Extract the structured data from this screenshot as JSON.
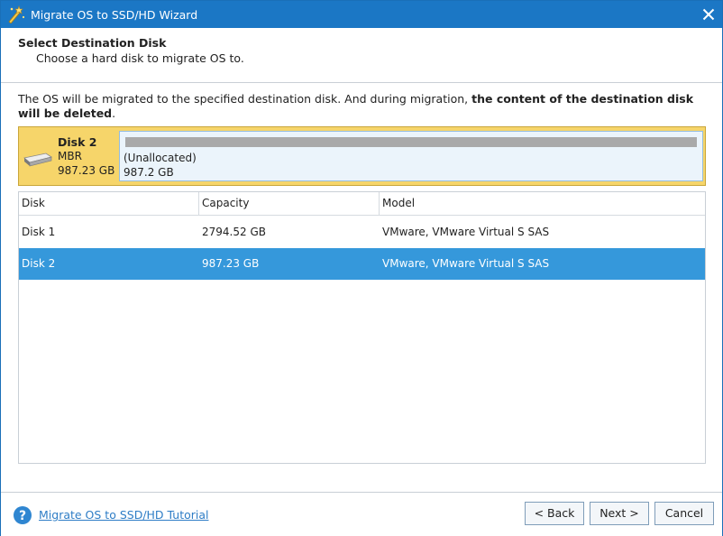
{
  "window": {
    "title": "Migrate OS to SSD/HD Wizard"
  },
  "header": {
    "title": "Select Destination Disk",
    "subtitle": "Choose a hard disk to migrate OS to."
  },
  "warning": {
    "normal": "The OS will be migrated to the specified destination disk. And during migration, ",
    "bold": "the content of the destination disk will be deleted",
    "end": "."
  },
  "selected_disk": {
    "name": "Disk 2",
    "type": "MBR",
    "size": "987.23 GB",
    "partition_label": "(Unallocated)",
    "partition_size": "987.2 GB"
  },
  "table": {
    "columns": [
      "Disk",
      "Capacity",
      "Model"
    ],
    "rows": [
      {
        "disk": "Disk 1",
        "capacity": "2794.52 GB",
        "model": "VMware, VMware Virtual S SAS"
      },
      {
        "disk": "Disk 2",
        "capacity": "987.23 GB",
        "model": "VMware, VMware Virtual S SAS"
      }
    ],
    "selected_row": "Disk 2"
  },
  "footer": {
    "tutorial_link": "Migrate OS to SSD/HD Tutorial",
    "back_label": "< Back",
    "next_label": "Next >",
    "cancel_label": "Cancel"
  },
  "colors": {
    "titlebar": "#1b77c5",
    "selection": "#3598db",
    "disk_panel": "#f6d56a",
    "link": "#2e7dc6"
  },
  "icons": {
    "app": "wizard-wand-icon",
    "close": "close-icon",
    "disk": "hard-disk-icon",
    "help": "help-question-icon"
  }
}
